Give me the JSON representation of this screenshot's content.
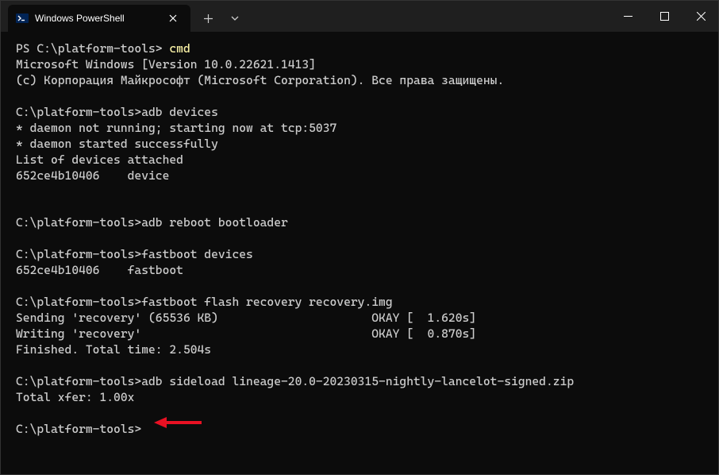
{
  "tab": {
    "title": "Windows PowerShell"
  },
  "terminal": {
    "line1_prompt": "PS C:\\platform-tools> ",
    "line1_cmd": "cmd",
    "line2": "Microsoft Windows [Version 10.0.22621.1413]",
    "line3": "(c) Корпорация Майкрософт (Microsoft Corporation). Все права защищены.",
    "line4": "",
    "line5": "C:\\platform-tools>adb devices",
    "line6": "* daemon not running; starting now at tcp:5037",
    "line7": "* daemon started successfully",
    "line8": "List of devices attached",
    "line9": "652ce4b10406    device",
    "line10": "",
    "line11": "",
    "line12": "C:\\platform-tools>adb reboot bootloader",
    "line13": "",
    "line14": "C:\\platform-tools>fastboot devices",
    "line15": "652ce4b10406    fastboot",
    "line16": "",
    "line17": "C:\\platform-tools>fastboot flash recovery recovery.img",
    "line18": "Sending 'recovery' (65536 KB)                      OKAY [  1.620s]",
    "line19": "Writing 'recovery'                                 OKAY [  0.870s]",
    "line20": "Finished. Total time: 2.504s",
    "line21": "",
    "line22": "C:\\platform-tools>adb sideload lineage-20.0-20230315-nightly-lancelot-signed.zip",
    "line23": "Total xfer: 1.00x",
    "line24": "",
    "line25": "C:\\platform-tools>"
  }
}
